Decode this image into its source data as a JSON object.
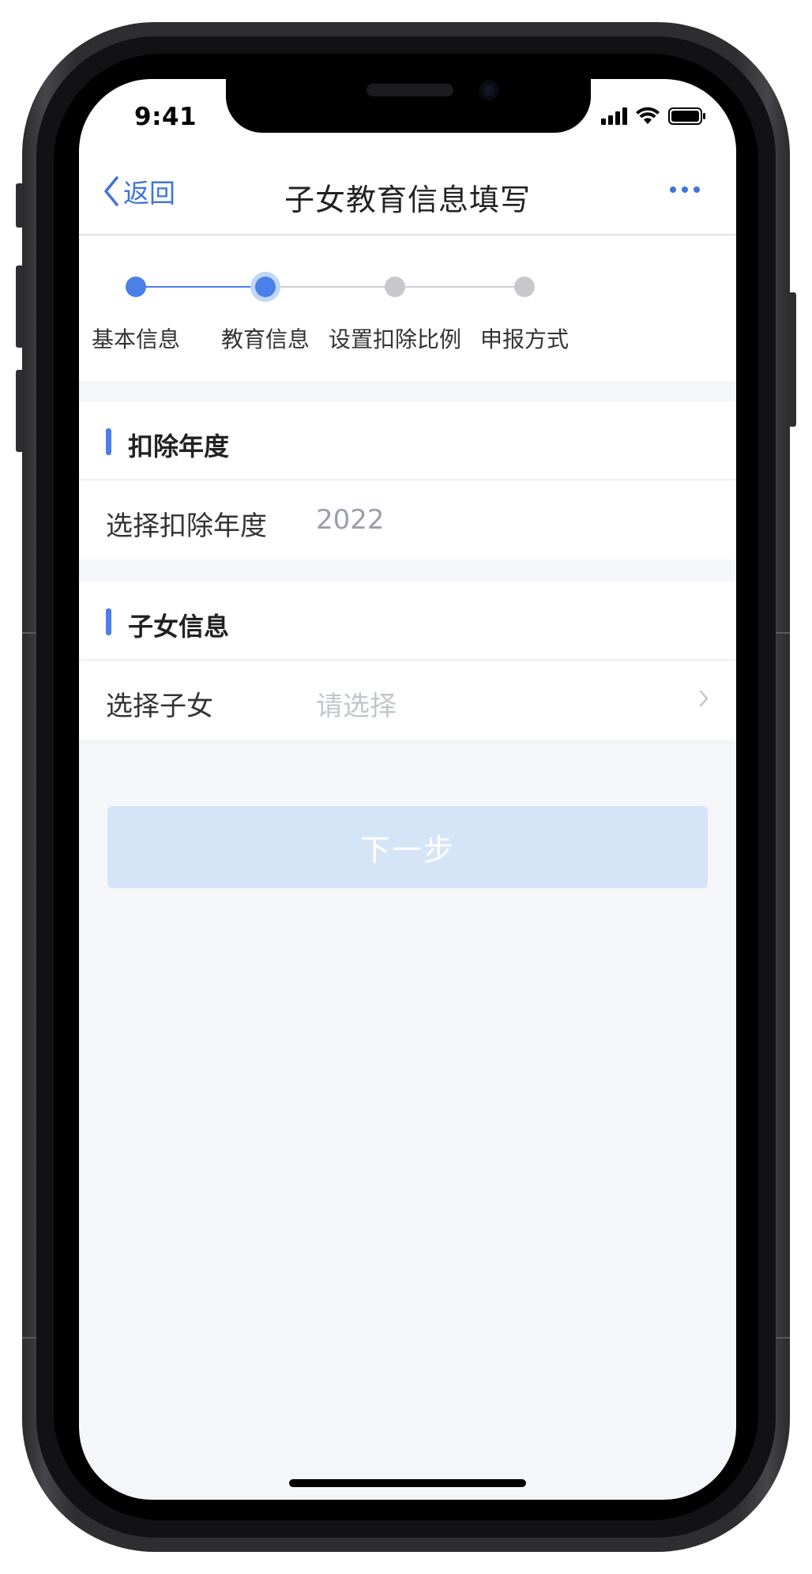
{
  "status_bar": {
    "time": "9:41",
    "signal_icon": "cellular-signal-icon",
    "wifi_icon": "wifi-icon",
    "battery_icon": "battery-icon"
  },
  "nav": {
    "back_label": "返回",
    "back_icon": "chevron-left-icon",
    "title": "子女教育信息填写",
    "more_icon": "more-dots-icon"
  },
  "stepper": {
    "steps": [
      {
        "label": "基本信息",
        "state": "done"
      },
      {
        "label": "教育信息",
        "state": "current"
      },
      {
        "label": "设置扣除比例",
        "state": "todo"
      },
      {
        "label": "申报方式",
        "state": "todo"
      }
    ]
  },
  "deduction_year": {
    "section_title": "扣除年度",
    "label": "选择扣除年度",
    "value": "2022"
  },
  "child_info": {
    "section_title": "子女信息",
    "label": "选择子女",
    "placeholder": "请选择",
    "chevron_icon": "chevron-right-icon"
  },
  "actions": {
    "next_label": "下一步"
  },
  "colors": {
    "accent": "#4a80e8",
    "link": "#3f74dc",
    "button_disabled": "#d6e4f8",
    "page_background": "#f5f6fa"
  }
}
